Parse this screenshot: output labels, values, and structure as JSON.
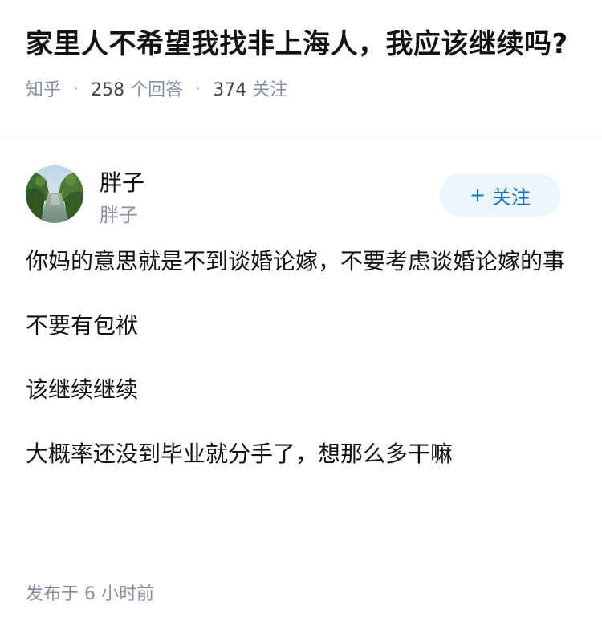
{
  "question": {
    "title": "家里人不希望我找非上海人，我应该继续吗?",
    "source": "知乎",
    "answers_count": "258",
    "answers_label": "个回答",
    "followers_count": "374",
    "followers_label": "关注"
  },
  "author": {
    "name": "胖子",
    "subtitle": "胖子",
    "follow_plus": "+",
    "follow_label": "关注"
  },
  "answer": {
    "paragraphs": [
      "你妈的意思就是不到谈婚论嫁，不要考虑谈婚论嫁的事",
      "不要有包袱",
      "该继续继续",
      "大概率还没到毕业就分手了，想那么多干嘛"
    ],
    "published_prefix": "发布于",
    "published_time": "6 小时前"
  },
  "colors": {
    "title": "#121212",
    "meta": "#8590a6",
    "follow_bg": "#ebf5fd",
    "follow_text": "#0a6fce"
  }
}
